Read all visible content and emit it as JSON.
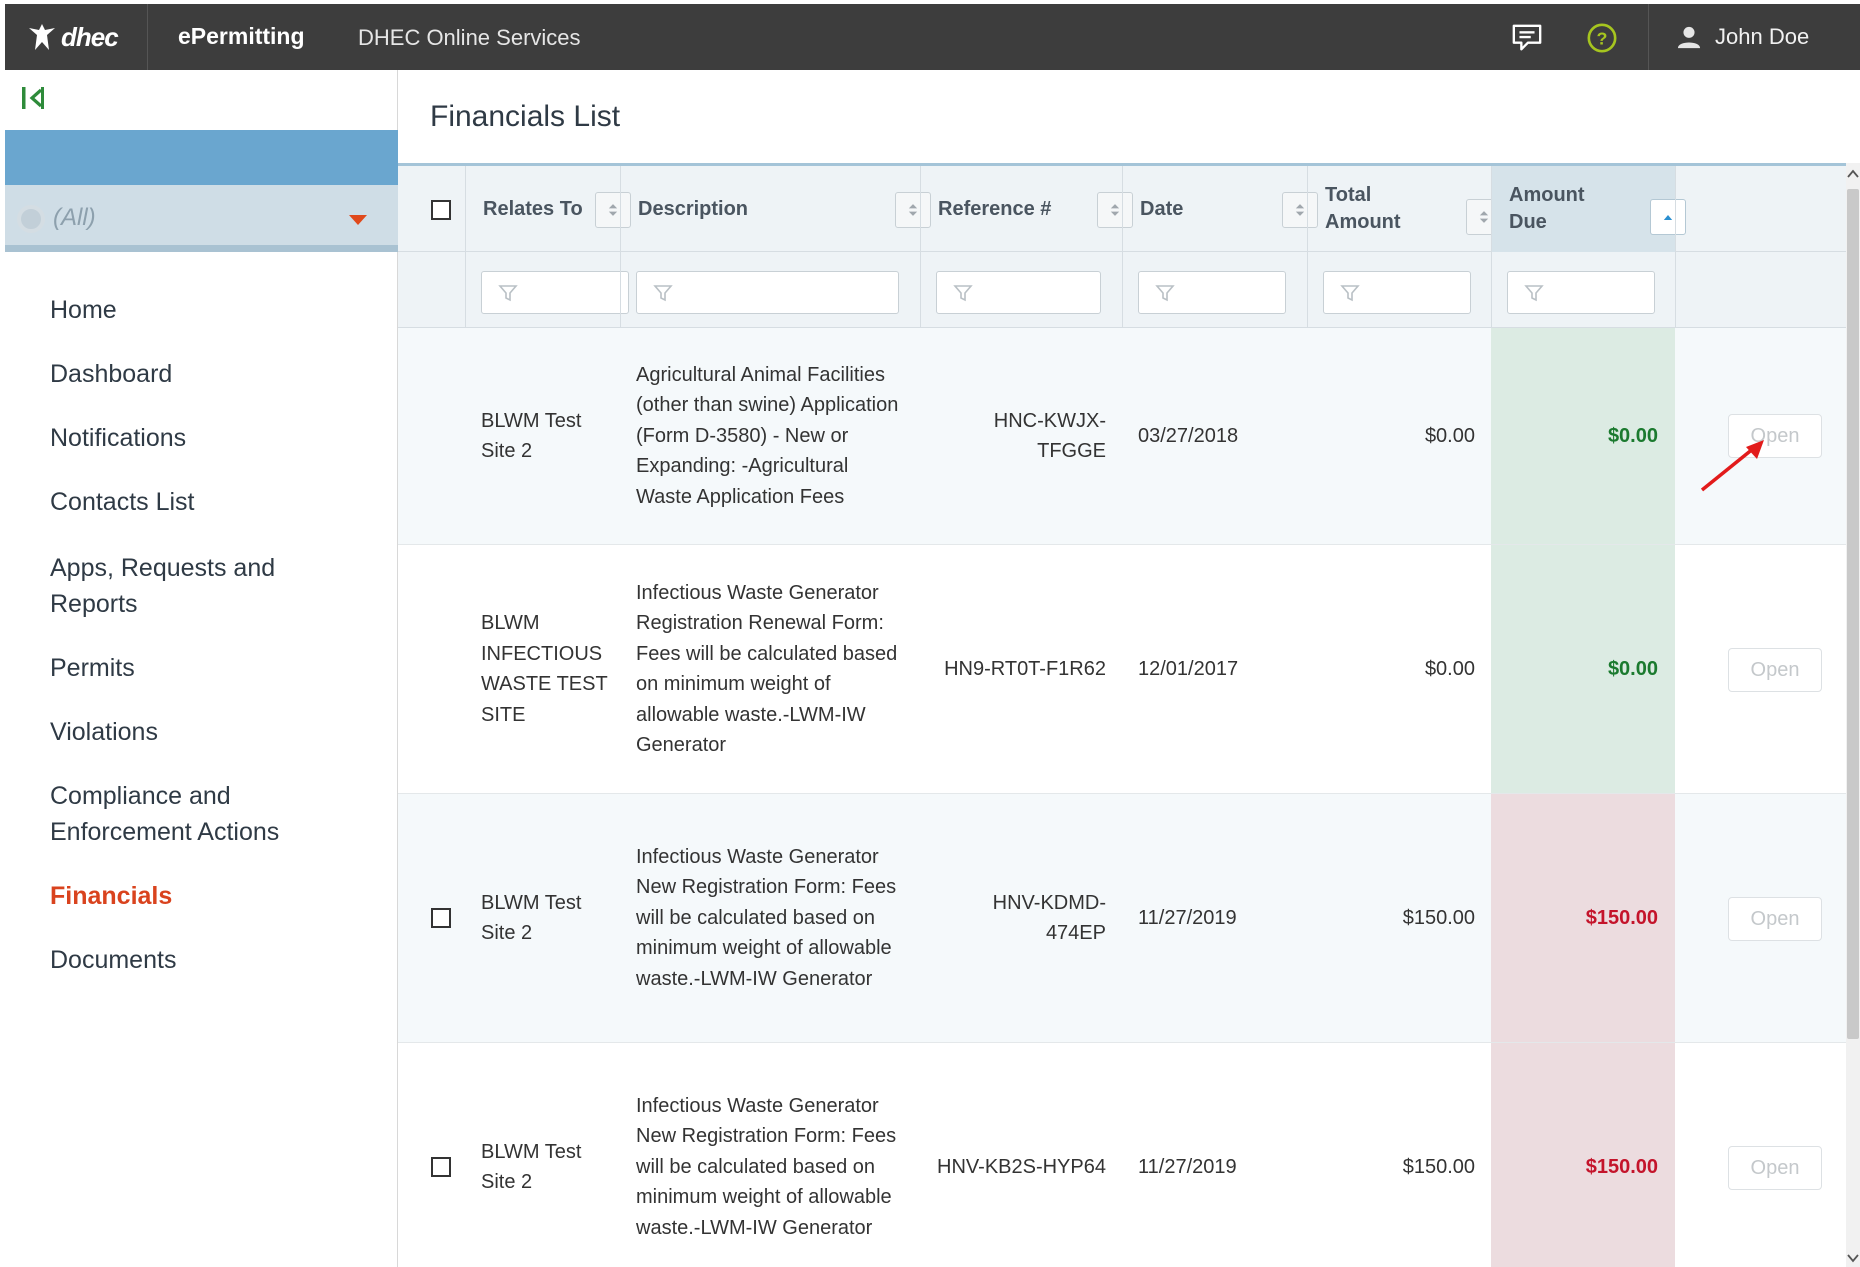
{
  "header": {
    "logo_text": "dhec",
    "brand": "ePermitting",
    "online_services": "DHEC Online Services",
    "user_name": "John Doe",
    "icons": [
      "chat-icon",
      "help-icon",
      "user-icon"
    ],
    "help_color": "#a6c51f"
  },
  "sidebar": {
    "filter_value": "(All)",
    "items": [
      {
        "label": "Home"
      },
      {
        "label": "Dashboard"
      },
      {
        "label": "Notifications"
      },
      {
        "label": "Contacts List"
      },
      {
        "label": "Apps, Requests and Reports"
      },
      {
        "label": "Permits"
      },
      {
        "label": "Violations"
      },
      {
        "label": "Compliance and Enforcement Actions"
      },
      {
        "label": "Financials",
        "active": true
      },
      {
        "label": "Documents"
      }
    ],
    "active_color": "#d9431e"
  },
  "main": {
    "title": "Financials List",
    "columns": {
      "relates_to": "Relates To",
      "description": "Description",
      "reference": "Reference #",
      "date": "Date",
      "total_amount": "Total Amount",
      "amount_due": "Amount Due"
    },
    "rows": [
      {
        "relates_to": "BLWM Test Site 2",
        "description": "Agricultural Animal Facilities (other than swine) Application (Form D-3580) - New or Expanding: -Agricultural Waste Application Fees",
        "reference": "HNC-KWJX-TFGGE",
        "date": "03/27/2018",
        "total_amount": "$0.00",
        "amount_due": "$0.00",
        "status": "paid",
        "action": "Open"
      },
      {
        "relates_to": "BLWM INFECTIOUS WASTE TEST SITE",
        "description": "Infectious Waste Generator Registration Renewal Form: Fees will be calculated based on minimum weight of allowable waste.-LWM-IW Generator",
        "reference": "HN9-RT0T-F1R62",
        "date": "12/01/2017",
        "total_amount": "$0.00",
        "amount_due": "$0.00",
        "status": "paid",
        "action": "Open"
      },
      {
        "relates_to": "BLWM Test Site 2",
        "description": "Infectious Waste Generator New Registration Form: Fees will be calculated based on minimum weight of allowable waste.-LWM-IW Generator",
        "reference": "HNV-KDMD-474EP",
        "date": "11/27/2019",
        "total_amount": "$150.00",
        "amount_due": "$150.00",
        "status": "due",
        "action": "Open"
      },
      {
        "relates_to": "BLWM Test Site 2",
        "description": "Infectious Waste Generator New Registration Form: Fees will be calculated based on minimum weight of allowable waste.-LWM-IW Generator",
        "reference": "HNV-KB2S-HYP64",
        "date": "11/27/2019",
        "total_amount": "$150.00",
        "amount_due": "$150.00",
        "status": "due",
        "action": "Open"
      }
    ],
    "colors": {
      "paid": "#1b7a2f",
      "due": "#c4142b",
      "annotation_arrow": "#e21b1b"
    }
  }
}
